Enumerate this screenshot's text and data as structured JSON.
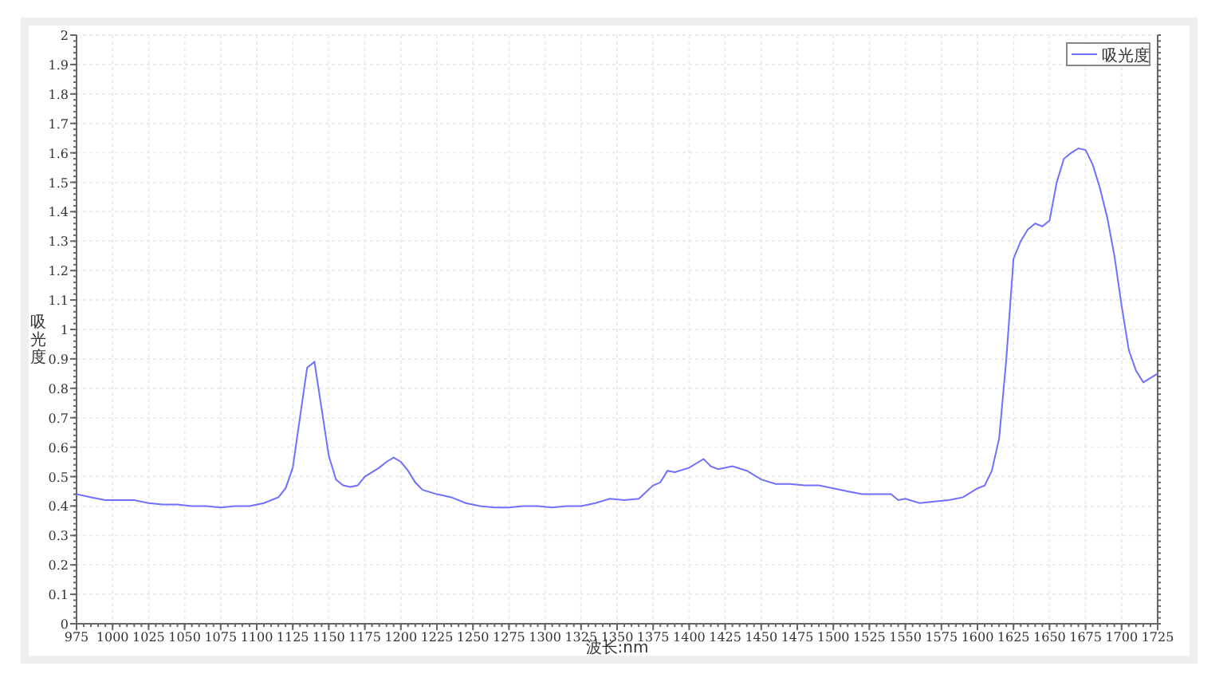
{
  "chart": {
    "chart_data": {
      "type": "line",
      "xlabel": "波长:nm",
      "ylabel": "吸光度",
      "x": [
        975,
        985,
        995,
        1005,
        1015,
        1025,
        1035,
        1045,
        1055,
        1065,
        1075,
        1085,
        1095,
        1105,
        1115,
        1120,
        1125,
        1130,
        1135,
        1140,
        1145,
        1150,
        1155,
        1160,
        1165,
        1170,
        1175,
        1185,
        1190,
        1195,
        1200,
        1205,
        1210,
        1215,
        1225,
        1235,
        1245,
        1255,
        1265,
        1275,
        1285,
        1295,
        1305,
        1315,
        1325,
        1335,
        1345,
        1355,
        1365,
        1375,
        1380,
        1385,
        1390,
        1400,
        1410,
        1415,
        1420,
        1430,
        1440,
        1450,
        1460,
        1470,
        1480,
        1490,
        1500,
        1510,
        1520,
        1530,
        1540,
        1545,
        1550,
        1560,
        1570,
        1580,
        1590,
        1600,
        1605,
        1610,
        1615,
        1620,
        1625,
        1630,
        1635,
        1640,
        1645,
        1650,
        1655,
        1660,
        1665,
        1670,
        1675,
        1680,
        1685,
        1690,
        1695,
        1700,
        1705,
        1710,
        1715,
        1725
      ],
      "series": [
        {
          "name": "吸光度",
          "color": "#7070ff",
          "values": [
            0.44,
            0.43,
            0.42,
            0.42,
            0.42,
            0.41,
            0.405,
            0.405,
            0.4,
            0.4,
            0.395,
            0.4,
            0.4,
            0.41,
            0.43,
            0.46,
            0.53,
            0.7,
            0.87,
            0.89,
            0.73,
            0.57,
            0.49,
            0.47,
            0.465,
            0.47,
            0.5,
            0.53,
            0.55,
            0.565,
            0.55,
            0.52,
            0.48,
            0.455,
            0.44,
            0.43,
            0.41,
            0.4,
            0.395,
            0.395,
            0.4,
            0.4,
            0.395,
            0.4,
            0.4,
            0.41,
            0.425,
            0.42,
            0.425,
            0.47,
            0.48,
            0.52,
            0.515,
            0.53,
            0.56,
            0.535,
            0.525,
            0.535,
            0.52,
            0.49,
            0.475,
            0.475,
            0.47,
            0.47,
            0.46,
            0.45,
            0.44,
            0.44,
            0.44,
            0.42,
            0.425,
            0.41,
            0.415,
            0.42,
            0.43,
            0.46,
            0.47,
            0.52,
            0.63,
            0.9,
            1.24,
            1.3,
            1.34,
            1.36,
            1.35,
            1.37,
            1.5,
            1.58,
            1.6,
            1.615,
            1.61,
            1.56,
            1.48,
            1.38,
            1.25,
            1.08,
            0.93,
            0.86,
            0.82,
            0.85
          ]
        }
      ],
      "grid": true,
      "xlim": [
        975,
        1725
      ],
      "ylim": [
        0,
        2
      ],
      "xticks": [
        975,
        1000,
        1025,
        1050,
        1075,
        1100,
        1125,
        1150,
        1175,
        1200,
        1225,
        1250,
        1275,
        1300,
        1325,
        1350,
        1375,
        1400,
        1425,
        1450,
        1475,
        1500,
        1525,
        1550,
        1575,
        1600,
        1625,
        1650,
        1675,
        1700,
        1725
      ],
      "yticks": [
        0,
        0.1,
        0.2,
        0.3,
        0.4,
        0.5,
        0.6,
        0.7,
        0.8,
        0.9,
        1,
        1.1,
        1.2,
        1.3,
        1.4,
        1.5,
        1.6,
        1.7,
        1.8,
        1.9,
        2
      ]
    }
  }
}
